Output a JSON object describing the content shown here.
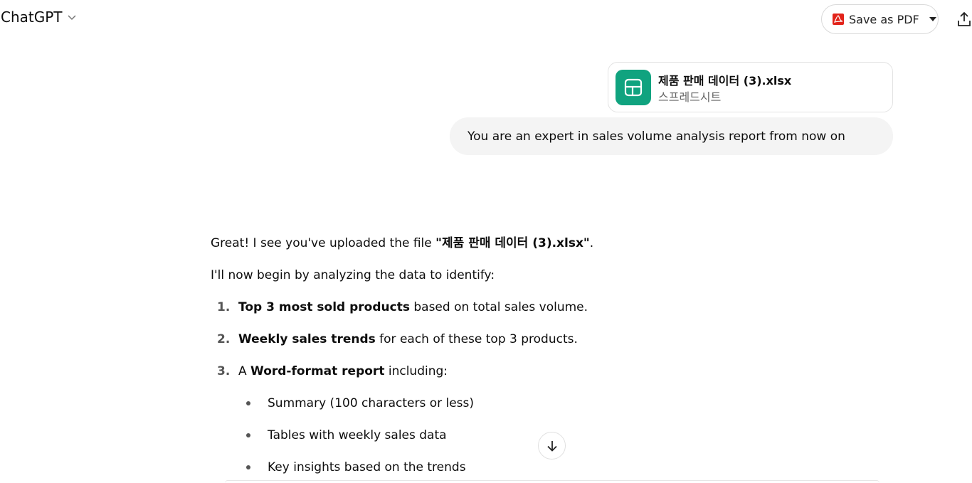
{
  "header": {
    "app_title": "ChatGPT",
    "save_pdf_label": "Save as PDF"
  },
  "attachment": {
    "file_name": "제품 판매 데이터 (3).xlsx",
    "file_type": "스프레드시트",
    "icon_color": "#10a37f"
  },
  "user_message": "You are an expert in sales volume analysis report from now on",
  "assistant": {
    "intro_prefix": "Great! I see you've uploaded the file ",
    "intro_file": "\"제품 판매 데이터 (3).xlsx\"",
    "intro_suffix": ".",
    "line2": "I'll now begin by analyzing the data to identify:",
    "list": [
      {
        "num": "1.",
        "bold": "Top 3 most sold products",
        "rest": " based on total sales volume."
      },
      {
        "num": "2.",
        "bold": "Weekly sales trends",
        "rest": " for each of these top 3 products."
      },
      {
        "num": "3.",
        "prefix": "A ",
        "bold": "Word-format report",
        "rest": " including:"
      }
    ],
    "sublist": [
      "Summary (100 characters or less)",
      "Tables with weekly sales data",
      "Key insights based on the trends"
    ]
  }
}
